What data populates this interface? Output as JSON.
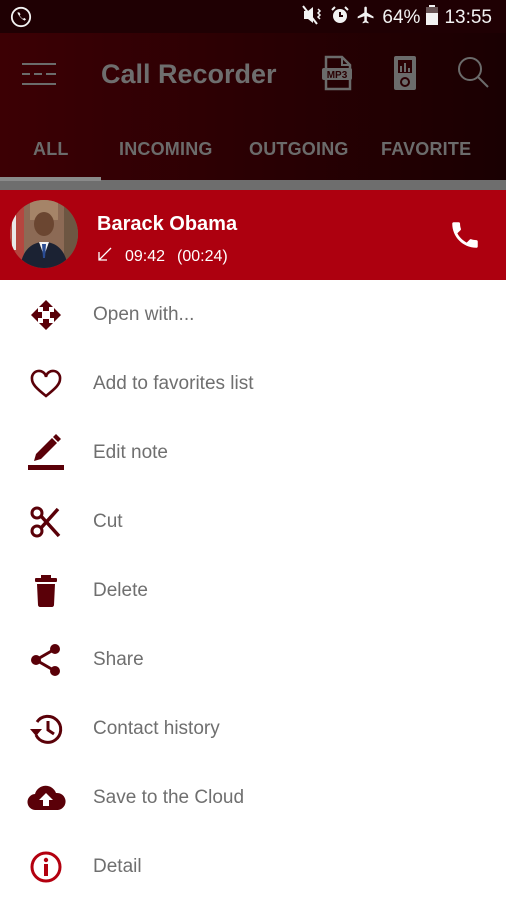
{
  "status_bar": {
    "left_icon": "whatsapp-call-icon",
    "icons": [
      "mute-vibrate-icon",
      "alarm-icon",
      "airplane-mode-icon",
      "battery-icon"
    ],
    "battery": "64%",
    "time": "13:55"
  },
  "app_bar": {
    "title": "Call Recorder",
    "actions": [
      "mp3-file-icon",
      "media-player-icon",
      "search-icon"
    ]
  },
  "tabs": [
    {
      "label": "ALL",
      "selected": true
    },
    {
      "label": "INCOMING",
      "selected": false
    },
    {
      "label": "OUTGOING",
      "selected": false
    },
    {
      "label": "FAVORITE",
      "selected": false
    }
  ],
  "record": {
    "name": "Barack Obama",
    "direction_icon": "incoming-call-arrow-icon",
    "time": "09:42",
    "duration": "(00:24)",
    "action_icon": "phone-icon"
  },
  "menu": [
    {
      "label": "Open with...",
      "icon": "move-arrows-icon"
    },
    {
      "label": "Add to favorites list",
      "icon": "heart-outline-icon"
    },
    {
      "label": "Edit note",
      "icon": "pencil-icon"
    },
    {
      "label": "Cut",
      "icon": "scissors-icon"
    },
    {
      "label": "Delete",
      "icon": "trash-icon"
    },
    {
      "label": "Share",
      "icon": "share-icon"
    },
    {
      "label": "Contact history",
      "icon": "history-icon"
    },
    {
      "label": "Save to the Cloud",
      "icon": "cloud-upload-icon"
    },
    {
      "label": "Detail",
      "icon": "info-icon"
    }
  ],
  "colors": {
    "record_bg": "#ad000f",
    "icon_dark": "#5a0008",
    "info_icon": "#b3000f",
    "menu_text": "#6f6f6f"
  }
}
